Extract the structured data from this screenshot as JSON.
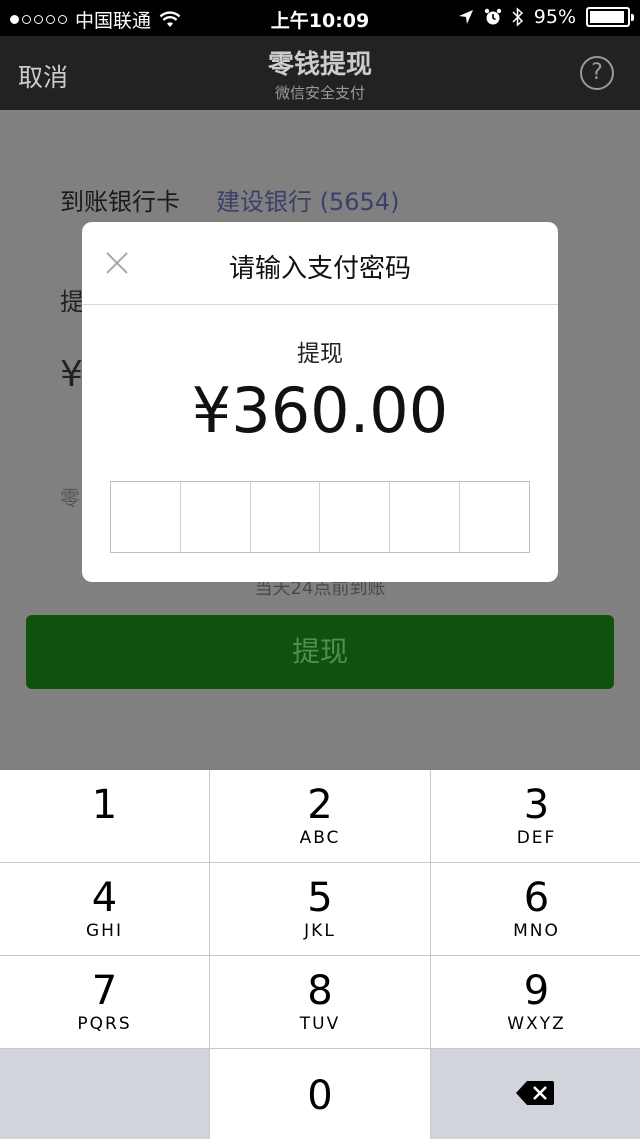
{
  "status_bar": {
    "carrier": "中国联通",
    "time": "上午10:09",
    "battery": "95%",
    "battery_level": 0.95
  },
  "nav": {
    "cancel_label": "取消",
    "title": "零钱提现",
    "subtitle": "微信安全支付",
    "help_label": "?"
  },
  "form": {
    "bank_label": "到账银行卡",
    "bank_value": "建设银行 (5654)",
    "amount_label_partial": "提",
    "amount_currency_partial": "¥",
    "balance_partial": "零",
    "arrival_note": "当天24点前到账",
    "withdraw_button": "提现"
  },
  "dialog": {
    "title": "请输入支付密码",
    "label": "提现",
    "amount": "¥360.00",
    "pin_length": 6
  },
  "keypad": {
    "keys": [
      {
        "num": "1",
        "letters": ""
      },
      {
        "num": "2",
        "letters": "ABC"
      },
      {
        "num": "3",
        "letters": "DEF"
      },
      {
        "num": "4",
        "letters": "GHI"
      },
      {
        "num": "5",
        "letters": "JKL"
      },
      {
        "num": "6",
        "letters": "MNO"
      },
      {
        "num": "7",
        "letters": "PQRS"
      },
      {
        "num": "8",
        "letters": "TUV"
      },
      {
        "num": "9",
        "letters": "WXYZ"
      }
    ],
    "zero": "0"
  },
  "icons": {
    "wifi": "wifi-icon",
    "location": "location-arrow-icon",
    "alarm": "alarm-icon",
    "bluetooth": "bluetooth-icon",
    "close": "close-icon",
    "delete": "backspace-icon"
  }
}
